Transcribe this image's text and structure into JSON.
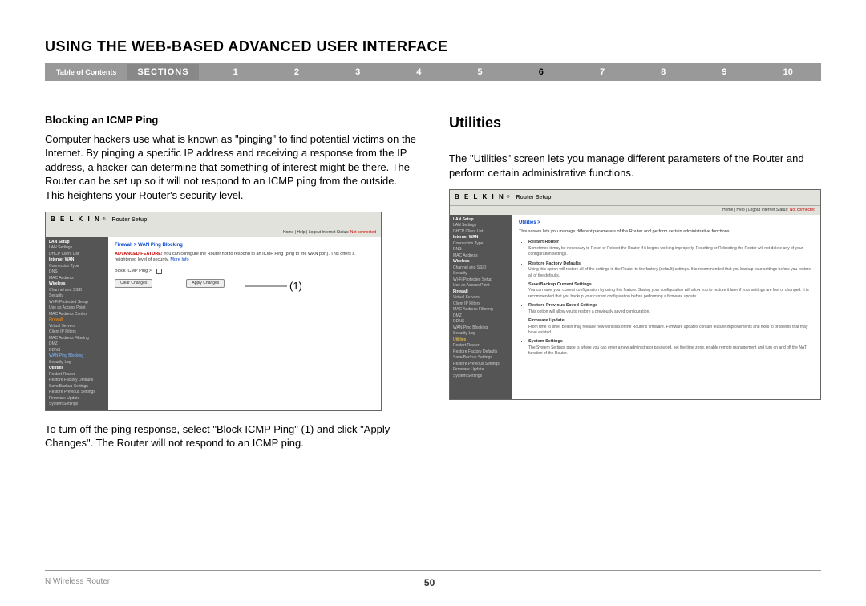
{
  "page_title": "USING THE WEB-BASED ADVANCED USER INTERFACE",
  "nav": {
    "toc": "Table of Contents",
    "sections_label": "SECTIONS",
    "numbers": [
      "1",
      "2",
      "3",
      "4",
      "5",
      "6",
      "7",
      "8",
      "9",
      "10"
    ],
    "active_index": 5
  },
  "left": {
    "subheading": "Blocking an ICMP Ping",
    "p1": "Computer hackers use what is known as \"pinging\" to find potential victims on the Internet. By pinging a specific IP address and receiving a response from the IP address, a hacker can determine that something of interest might be there. The Router can be set up so it will not respond to an ICMP ping from the outside. This heightens your Router's security level.",
    "p2": "To turn off the ping response, select \"Block ICMP Ping\" (1) and click \"Apply Changes\". The Router will not respond to an ICMP ping.",
    "annot1": "(1)"
  },
  "right": {
    "heading": "Utilities",
    "p1": "The \"Utilities\" screen lets you manage different parameters of the Router and perform certain administrative functions."
  },
  "shot1": {
    "logo": "B E L K I N",
    "router_setup": "Router Setup",
    "top_links": "Home | Help | Logout  Internet Status:",
    "not_connected": "Not connected",
    "crumb": "Firewall > WAN Ping Blocking",
    "adv_label": "ADVANCED FEATURE!",
    "adv_text": " You can configure the Router not to respond to an ICMP Ping (ping to the WAN port). This offers a heightened level of security. ",
    "more": "More Info",
    "block_label": "Block ICMP Ping >",
    "btn_clear": "Clear Changes",
    "btn_apply": "Apply Changes",
    "sidebar": [
      "LAN Setup",
      "LAN Settings",
      "DHCP Client List",
      "Internet WAN",
      "Connection Type",
      "DNS",
      "MAC Address",
      "Wireless",
      "Channel and SSID",
      "Security",
      "Wi-Fi Protected Setup",
      "Use as Access Point",
      "MAC Address Control",
      "Firewall",
      "Virtual Servers",
      "Client IP Filters",
      "MAC Address Filtering",
      "DMZ",
      "DDNS",
      "WAN Ping Blocking",
      "Security Log",
      "Utilities",
      "Restart Router",
      "Restore Factory Defaults",
      "Save/Backup Settings",
      "Restore Previous Settings",
      "Firmware Update",
      "System Settings"
    ]
  },
  "shot2": {
    "crumb": "Utilities >",
    "intro": "This screen lets you manage different parameters of the Router and perform certain administrative functions.",
    "items": [
      {
        "t": "Restart Router",
        "d": "Sometimes it may be necessary to Reset or Reboot the Router if it begins working improperly. Resetting or Rebooting the Router will not delete any of your configuration settings."
      },
      {
        "t": "Restore Factory Defaults",
        "d": "Using this option will restore all of the settings in the Router to the factory (default) settings. It is recommended that you backup your settings before you restore all of the defaults."
      },
      {
        "t": "Save/Backup Current Settings",
        "d": "You can save your current configuration by using this feature. Saving your configuration will allow you to restore it later if your settings are lost or changed. It is recommended that you backup your current configuration before performing a firmware update."
      },
      {
        "t": "Restore Previous Saved Settings",
        "d": "This option will allow you to restore a previously saved configuration."
      },
      {
        "t": "Firmware Update",
        "d": "From time to time, Belkin may release new versions of the Router's firmware. Firmware updates contain feature improvements and fixes to problems that may have existed."
      },
      {
        "t": "System Settings",
        "d": "The System Settings page is where you can enter a new administrator password, set the time zone, enable remote management and turn on and off the NAT function of the Router."
      }
    ],
    "sidebar": [
      "LAN Setup",
      "LAN Settings",
      "DHCP Client List",
      "Internet WAN",
      "Connection Type",
      "DNS",
      "MAC Address",
      "Wireless",
      "Channel and SSID",
      "Security",
      "Wi-Fi Protected Setup",
      "Use as Access Point",
      "Firewall",
      "Virtual Servers",
      "Client IP Filters",
      "MAC Address Filtering",
      "DMZ",
      "DDNS",
      "WAN Ping Blocking",
      "Security Log",
      "Utilities",
      "Restart Router",
      "Restore Factory Defaults",
      "Save/Backup Settings",
      "Restore Previous Settings",
      "Firmware Update",
      "System Settings"
    ]
  },
  "footer": {
    "left": "N Wireless Router",
    "page": "50"
  }
}
